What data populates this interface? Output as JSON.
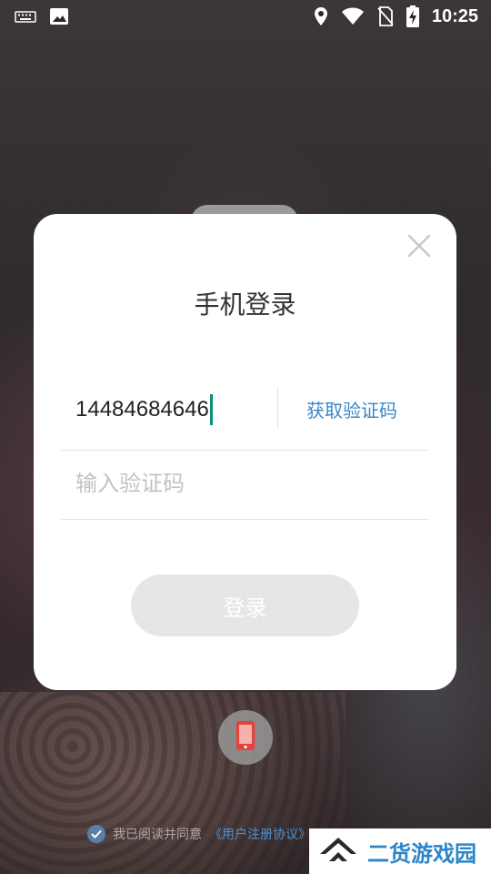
{
  "status_bar": {
    "time": "10:25",
    "icons": [
      "keyboard-icon",
      "image-icon",
      "location-icon",
      "wifi-icon",
      "no-sim-icon",
      "battery-charging-icon"
    ]
  },
  "dialog": {
    "title": "手机登录",
    "phone_value": "14484684646",
    "get_code_label": "获取验证码",
    "code_placeholder": "输入验证码",
    "login_label": "登录"
  },
  "agreement": {
    "text": "我已阅读并同意",
    "link": "《用户注册协议》"
  },
  "watermark": {
    "text": "二货游戏园"
  },
  "colors": {
    "accent": "#3a86c8",
    "caret": "#0c8f7f",
    "login_disabled": "#e6e6e6",
    "watermark": "#2c85c9"
  }
}
